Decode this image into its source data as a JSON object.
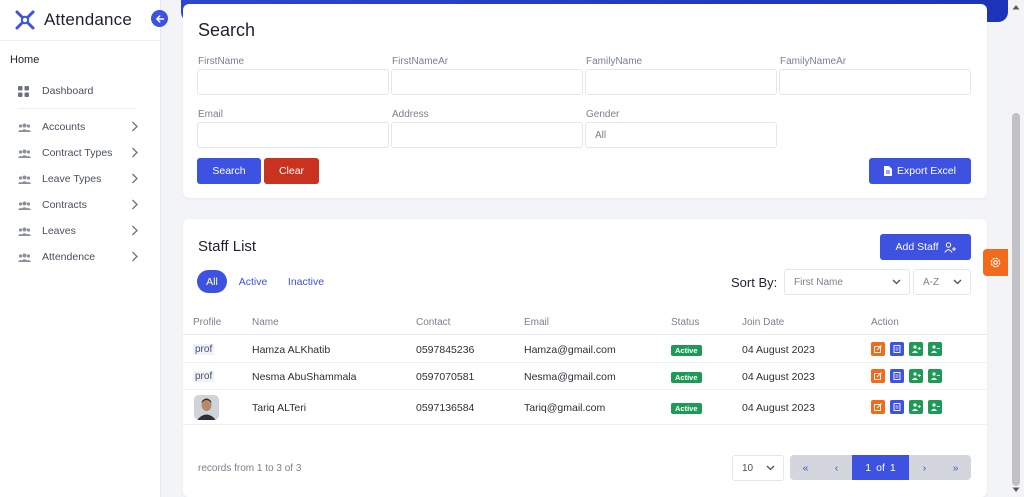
{
  "app": {
    "title": "Attendance"
  },
  "sidebar": {
    "section": "Home",
    "dashboard": "Dashboard",
    "items": [
      {
        "label": "Accounts"
      },
      {
        "label": "Contract Types"
      },
      {
        "label": "Leave Types"
      },
      {
        "label": "Contracts"
      },
      {
        "label": "Leaves"
      },
      {
        "label": "Attendence"
      }
    ]
  },
  "search": {
    "title": "Search",
    "fields": {
      "first_name": "FirstName",
      "first_name_ar": "FirstNameAr",
      "family_name": "FamilyName",
      "family_name_ar": "FamilyNameAr",
      "email": "Email",
      "address": "Address",
      "gender": "Gender"
    },
    "gender_value": "All",
    "search_label": "Search",
    "clear_label": "Clear",
    "export_label": "Export Excel"
  },
  "staff": {
    "title": "Staff List",
    "add_label": "Add Staff",
    "tabs": {
      "all": "All",
      "active": "Active",
      "inactive": "Inactive"
    },
    "sort_label": "Sort By:",
    "sort_field": "First Name",
    "sort_order": "A-Z",
    "columns": {
      "profile": "Profile",
      "name": "Name",
      "contact": "Contact",
      "email": "Email",
      "status": "Status",
      "join_date": "Join Date",
      "action": "Action"
    },
    "broken_image_alt": "prof",
    "rows": [
      {
        "name": "Hamza ALKhatib",
        "contact": "0597845236",
        "email": "Hamza@gmail.com",
        "status": "Active",
        "join_date": "04 August 2023"
      },
      {
        "name": "Nesma AbuShammala",
        "contact": "0597070581",
        "email": "Nesma@gmail.com",
        "status": "Active",
        "join_date": "04 August 2023"
      },
      {
        "name": "Tariq ALTeri",
        "contact": "0597136584",
        "email": "Tariq@gmail.com",
        "status": "Active",
        "join_date": "04 August 2023"
      }
    ],
    "records_text": "records from 1 to 3 of 3",
    "page_size": "10",
    "pager": {
      "first": "«",
      "prev": "‹",
      "current": "1",
      "of": "of",
      "total": "1",
      "next": "›",
      "last": "»"
    }
  },
  "colors": {
    "accent": "#3d52e0",
    "danger": "#c8321e",
    "success": "#1e9a57",
    "warning": "#f26b1d"
  }
}
